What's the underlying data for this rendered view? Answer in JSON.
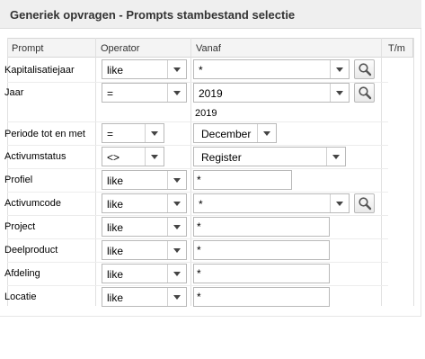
{
  "title": "Generiek opvragen - Prompts stambestand selectie",
  "columns": {
    "prompt": "Prompt",
    "operator": "Operator",
    "vanaf": "Vanaf",
    "tm": "T/m"
  },
  "rows": [
    {
      "label": "Kapitalisatiejaar",
      "operator": "like",
      "value": "*"
    },
    {
      "label": "Jaar",
      "operator": "=",
      "value": "2019",
      "hint": "2019"
    },
    {
      "label": "Periode tot en met",
      "operator": "=",
      "value": "December"
    },
    {
      "label": "Activumstatus",
      "operator": "<>",
      "value": "Register"
    },
    {
      "label": "Profiel",
      "operator": "like",
      "value": "*"
    },
    {
      "label": "Activumcode",
      "operator": "like",
      "value": "*"
    },
    {
      "label": "Project",
      "operator": "like",
      "value": "*"
    },
    {
      "label": "Deelproduct",
      "operator": "like",
      "value": "*"
    },
    {
      "label": "Afdeling",
      "operator": "like",
      "value": "*"
    },
    {
      "label": "Locatie",
      "operator": "like",
      "value": "*"
    }
  ]
}
